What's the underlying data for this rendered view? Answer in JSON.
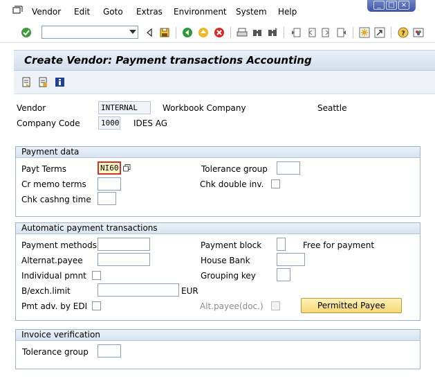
{
  "menu": {
    "items": [
      {
        "label": "Vendor",
        "key": "V"
      },
      {
        "label": "Edit",
        "key": "E"
      },
      {
        "label": "Goto",
        "key": "G"
      },
      {
        "label": "Extras",
        "key": "x"
      },
      {
        "label": "Environment",
        "key": "n"
      },
      {
        "label": "System",
        "key": "S"
      },
      {
        "label": "Help",
        "key": "H"
      }
    ]
  },
  "window_controls": {
    "minimize": "_",
    "maximize": "□",
    "close": "×"
  },
  "toolbar": {
    "command_field_value": "",
    "icons": [
      "check-icon",
      "back-icon",
      "save-icon",
      "nav-back-icon",
      "exit-icon",
      "cancel-icon",
      "print-icon",
      "find-icon",
      "find-next-icon",
      "first-page-icon",
      "prev-page-icon",
      "next-page-icon",
      "last-page-icon",
      "create-session-icon",
      "shortcut-icon",
      "help-icon",
      "layout-icon"
    ]
  },
  "title": "Create Vendor: Payment transactions Accounting",
  "header": {
    "vendor_label": "Vendor",
    "vendor_value": "INTERNAL",
    "vendor_name": "Workbook Company",
    "vendor_city": "Seattle",
    "company_code_label": "Company Code",
    "company_code_value": "1000",
    "company_name": "IDES AG"
  },
  "payment_data": {
    "title": "Payment data",
    "payt_terms_label": "Payt Terms",
    "payt_terms_value": "NI60",
    "tolerance_group_label": "Tolerance group",
    "tolerance_group_value": "",
    "cr_memo_terms_label": "Cr memo terms",
    "cr_memo_terms_value": "",
    "chk_double_inv_label": "Chk double inv.",
    "chk_double_inv_checked": false,
    "chk_cashng_time_label": "Chk cashng time",
    "chk_cashng_time_value": ""
  },
  "auto_payment": {
    "title": "Automatic payment transactions",
    "payment_methods_label": "Payment methods",
    "payment_methods_value": "",
    "payment_block_label": "Payment block",
    "payment_block_value": "",
    "payment_block_text": "Free for payment",
    "alternat_payee_label": "Alternat.payee",
    "alternat_payee_value": "",
    "house_bank_label": "House Bank",
    "house_bank_value": "",
    "individual_pmnt_label": "Individual pmnt",
    "individual_pmnt_checked": false,
    "grouping_key_label": "Grouping key",
    "grouping_key_value": "",
    "bexch_limit_label": "B/exch.limit",
    "bexch_limit_value": "",
    "bexch_currency": "EUR",
    "pmt_adv_edi_label": "Pmt adv. by EDI",
    "pmt_adv_edi_checked": false,
    "alt_payee_doc_label": "Alt.payee(doc.)",
    "alt_payee_doc_checked": false,
    "permitted_payee_button": "Permitted Payee"
  },
  "invoice_verification": {
    "title": "Invoice verification",
    "tolerance_group_label": "Tolerance group",
    "tolerance_group_value": ""
  },
  "colors": {
    "title_bar": "#d3dfec",
    "button_yellow": "#f6d875",
    "active_field_border": "#d03030",
    "window_controls": "#3c55a8"
  }
}
